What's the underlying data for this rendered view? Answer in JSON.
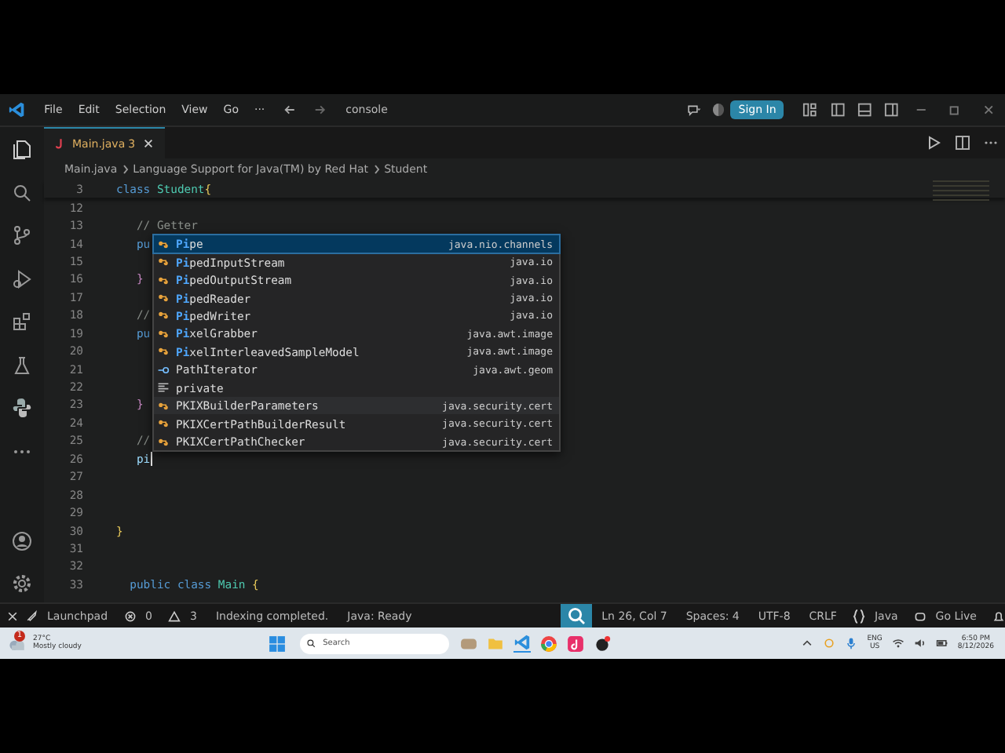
{
  "window": {
    "menu": [
      "File",
      "Edit",
      "Selection",
      "View",
      "Go",
      "···"
    ],
    "search": "console",
    "sign_in": "Sign In"
  },
  "tabs": [
    {
      "label": "Main.java",
      "badge": "3",
      "selected": true
    }
  ],
  "breadcrumb": [
    "Main.java",
    "Language Support for Java(TM) by Red Hat",
    "Student"
  ],
  "code_lines": [
    {
      "num": "3",
      "tokens": [
        {
          "t": "class ",
          "kind": "keyword"
        },
        {
          "t": "Student",
          "kind": "type"
        },
        {
          "t": "{",
          "kind": "brace"
        }
      ]
    },
    {
      "num": "12"
    },
    {
      "num": "13",
      "tokens": [
        {
          "t": "   // Getter",
          "kind": "comment"
        }
      ]
    },
    {
      "num": "14",
      "tokens": [
        {
          "t": "   pu",
          "kind": "keyword"
        }
      ]
    },
    {
      "num": "15"
    },
    {
      "num": "16",
      "tokens": [
        {
          "t": "   }",
          "kind": "brace2"
        }
      ]
    },
    {
      "num": "17"
    },
    {
      "num": "18",
      "tokens": [
        {
          "t": "   //",
          "kind": "comment"
        }
      ]
    },
    {
      "num": "19",
      "tokens": [
        {
          "t": "   pu",
          "kind": "keyword"
        }
      ]
    },
    {
      "num": "20"
    },
    {
      "num": "21"
    },
    {
      "num": "22"
    },
    {
      "num": "23",
      "tokens": [
        {
          "t": "   }",
          "kind": "brace2"
        }
      ]
    },
    {
      "num": "24"
    },
    {
      "num": "25",
      "tokens": [
        {
          "t": "   //",
          "kind": "comment"
        }
      ]
    },
    {
      "num": "26",
      "tokens": [
        {
          "t": "   pi",
          "kind": "plain"
        }
      ],
      "cursor": true
    },
    {
      "num": "27"
    },
    {
      "num": "28"
    },
    {
      "num": "29"
    },
    {
      "num": "30",
      "tokens": [
        {
          "t": "}",
          "kind": "brace"
        }
      ]
    },
    {
      "num": "31"
    },
    {
      "num": "32"
    },
    {
      "num": "33",
      "tokens": [
        {
          "t": "  public class ",
          "kind": "keyword"
        },
        {
          "t": "Main",
          "kind": "type"
        },
        {
          "t": " {",
          "kind": "brace"
        }
      ]
    }
  ],
  "suggestions": [
    {
      "label": "**Pi**pe",
      "detail": "java.nio.channels",
      "kind": "class",
      "selected": true
    },
    {
      "label": "**Pi**pedInputStream",
      "detail": "java.io",
      "kind": "class",
      "selected": false
    },
    {
      "label": "**Pi**pedOutputStream",
      "detail": "java.io",
      "kind": "class",
      "selected": false
    },
    {
      "label": "**Pi**pedReader",
      "detail": "java.io",
      "kind": "class",
      "selected": false
    },
    {
      "label": "**Pi**pedWriter",
      "detail": "java.io",
      "kind": "class",
      "selected": false
    },
    {
      "label": "**Pi**xelGrabber",
      "detail": "java.awt.image",
      "kind": "class",
      "selected": false
    },
    {
      "label": "**Pi**xelInterleavedSampleModel",
      "detail": "java.awt.image",
      "kind": "class",
      "selected": false
    },
    {
      "label": "PathIterator",
      "detail": "java.awt.geom",
      "kind": "interface",
      "selected": false
    },
    {
      "label": "private",
      "kind": "keyword",
      "selected": false
    },
    {
      "label": "PKIXBuilderParameters",
      "detail": "java.security.cert",
      "kind": "class",
      "selected": false
    },
    {
      "label": "PKIXCertPathBuilderResult",
      "detail": "java.security.cert",
      "kind": "class",
      "selected": false
    },
    {
      "label": "PKIXCertPathChecker",
      "detail": "java.security.cert",
      "kind": "class",
      "selected": false
    }
  ],
  "status_bar": {
    "launchpad": "Launchpad",
    "errors": "0",
    "warnings": "3",
    "indexing": "Indexing completed.",
    "java_status": "Java: Ready",
    "position": "Ln 26, Col 7",
    "spaces": "Spaces: 4",
    "encoding": "UTF-8",
    "eol": "CRLF",
    "language": "Java",
    "go_live": "Go Live"
  },
  "taskbar": {
    "weather_temp": "27°C",
    "weather_desc": "Mostly cloudy",
    "weather_badge": "1",
    "search_placeholder": "Search",
    "lang": "ENG",
    "region": "US",
    "time": "6:50 PM",
    "date": "8/12/2026"
  }
}
